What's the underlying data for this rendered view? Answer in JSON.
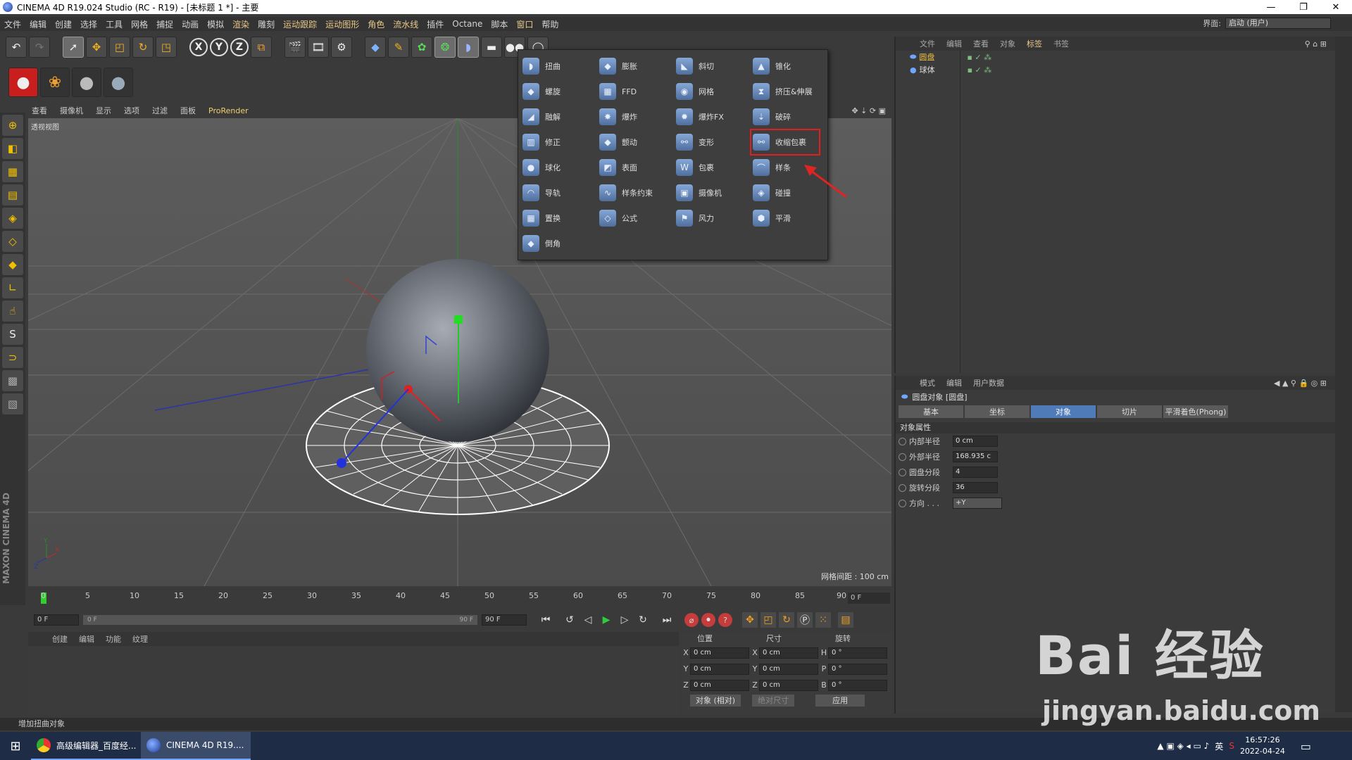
{
  "titlebar": {
    "title": "CINEMA 4D R19.024 Studio (RC - R19) - [未标题 1 *] - 主要",
    "min": "—",
    "max": "❐",
    "close": "✕"
  },
  "menu": {
    "items": [
      "文件",
      "编辑",
      "创建",
      "选择",
      "工具",
      "网格",
      "捕捉",
      "动画",
      "模拟",
      "渲染",
      "雕刻",
      "运动跟踪",
      "运动图形",
      "角色",
      "流水线",
      "插件",
      "Octane",
      "脚本",
      "窗口",
      "帮助"
    ],
    "interface_label": "界面:",
    "interface_value": "启动 (用户)"
  },
  "viewport": {
    "menu": [
      "查看",
      "摄像机",
      "显示",
      "选项",
      "过滤",
      "面板",
      "ProRender"
    ],
    "label": "透视视图",
    "grid_spacing": "网格间距 : 100 cm"
  },
  "deformers": [
    {
      "label": "扭曲",
      "icon": "twist"
    },
    {
      "label": "膨胀",
      "icon": "bulge"
    },
    {
      "label": "斜切",
      "icon": "shear"
    },
    {
      "label": "锥化",
      "icon": "taper"
    },
    {
      "label": "螺旋",
      "icon": "spiral"
    },
    {
      "label": "FFD",
      "icon": "ffd"
    },
    {
      "label": "网格",
      "icon": "mesh"
    },
    {
      "label": "挤压&伸展",
      "icon": "squash"
    },
    {
      "label": "融解",
      "icon": "melt"
    },
    {
      "label": "爆炸",
      "icon": "explode"
    },
    {
      "label": "爆炸FX",
      "icon": "explosionfx"
    },
    {
      "label": "破碎",
      "icon": "shatter"
    },
    {
      "label": "修正",
      "icon": "correction"
    },
    {
      "label": "颤动",
      "icon": "jiggle"
    },
    {
      "label": "变形",
      "icon": "morph"
    },
    {
      "label": "收缩包裹",
      "icon": "shrinkwrap"
    },
    {
      "label": "球化",
      "icon": "spherify"
    },
    {
      "label": "表面",
      "icon": "surface"
    },
    {
      "label": "包裹",
      "icon": "wrap"
    },
    {
      "label": "样条",
      "icon": "spline"
    },
    {
      "label": "导轨",
      "icon": "rail"
    },
    {
      "label": "样条约束",
      "icon": "splinewrap"
    },
    {
      "label": "摄像机",
      "icon": "camera"
    },
    {
      "label": "碰撞",
      "icon": "collision"
    },
    {
      "label": "置换",
      "icon": "displacer"
    },
    {
      "label": "公式",
      "icon": "formula"
    },
    {
      "label": "风力",
      "icon": "wind"
    },
    {
      "label": "平滑",
      "icon": "smoothing"
    },
    {
      "label": "倒角",
      "icon": "bevel"
    }
  ],
  "highlighted_deformer": "收缩包裹",
  "objects_panel": {
    "tabs": [
      "文件",
      "编辑",
      "查看",
      "对象",
      "标签",
      "书签"
    ],
    "active_tab": "标签",
    "objects": [
      {
        "name": "圆盘",
        "selected": true
      },
      {
        "name": "球体",
        "selected": false
      }
    ]
  },
  "attributes": {
    "menu": [
      "模式",
      "编辑",
      "用户数据"
    ],
    "object": "圆盘对象 [圆盘]",
    "tabs": [
      "基本",
      "坐标",
      "对象",
      "切片",
      "平滑着色(Phong)"
    ],
    "active_tab": "对象",
    "section": "对象属性",
    "props": [
      {
        "label": "内部半径",
        "value": "0 cm"
      },
      {
        "label": "外部半径",
        "value": "168.935 c"
      },
      {
        "label": "圆盘分段",
        "value": "4"
      },
      {
        "label": "旋转分段",
        "value": "36"
      },
      {
        "label": "方向 . . .",
        "value": "+Y"
      }
    ]
  },
  "timeline": {
    "ticks": [
      "0",
      "5",
      "10",
      "15",
      "20",
      "25",
      "30",
      "35",
      "40",
      "45",
      "50",
      "55",
      "60",
      "65",
      "70",
      "75",
      "80",
      "85",
      "90"
    ],
    "end_field": "0 F",
    "start": "0 F",
    "range_start": "0 F",
    "range_end": "90 F",
    "max": "90 F"
  },
  "materials": {
    "menu": [
      "创建",
      "编辑",
      "功能",
      "纹理"
    ]
  },
  "coords": {
    "headers": [
      "位置",
      "尺寸",
      "旋转"
    ],
    "rows": [
      {
        "a1": "X",
        "v1": "0 cm",
        "a2": "X",
        "v2": "0 cm",
        "a3": "H",
        "v3": "0 °"
      },
      {
        "a1": "Y",
        "v1": "0 cm",
        "a2": "Y",
        "v2": "0 cm",
        "a3": "P",
        "v3": "0 °"
      },
      {
        "a1": "Z",
        "v1": "0 cm",
        "a2": "Z",
        "v2": "0 cm",
        "a3": "B",
        "v3": "0 °"
      }
    ],
    "mode": "对象 (相对)",
    "size_mode": "绝对尺寸",
    "apply": "应用"
  },
  "status": "增加扭曲对象",
  "brand": "MAXON CINEMA 4D",
  "taskbar": {
    "tasks": [
      {
        "label": "高级编辑器_百度经...",
        "active": false
      },
      {
        "label": "CINEMA 4D R19....",
        "active": true
      }
    ],
    "lang": "英",
    "time": "16:57:26",
    "date": "2022-04-24"
  },
  "watermark": {
    "brand": "Bai 经验",
    "url": "jingyan.baidu.com"
  }
}
